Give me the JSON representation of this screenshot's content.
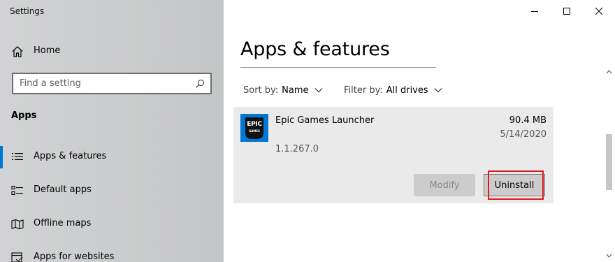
{
  "window": {
    "app_title": "Settings",
    "caption_buttons": [
      "minimize",
      "maximize",
      "close"
    ]
  },
  "sidebar": {
    "home_label": "Home",
    "search": {
      "placeholder": "Find a setting",
      "value": ""
    },
    "section_title": "Apps",
    "items": [
      {
        "label": "Apps & features",
        "icon": "list-icon",
        "selected": true
      },
      {
        "label": "Default apps",
        "icon": "default-apps-icon",
        "selected": false
      },
      {
        "label": "Offline maps",
        "icon": "map-icon",
        "selected": false
      },
      {
        "label": "Apps for websites",
        "icon": "apps-for-websites-icon",
        "selected": false
      }
    ]
  },
  "main": {
    "title": "Apps & features",
    "sort": {
      "label": "Sort by:",
      "value": "Name"
    },
    "filter": {
      "label": "Filter by:",
      "value": "All drives"
    },
    "app": {
      "name": "Epic Games Launcher",
      "size": "90.4 MB",
      "date": "5/14/2020",
      "version": "1.1.267.0",
      "logo_text": "EPIC",
      "logo_subtext": "GAMES",
      "modify_label": "Modify",
      "modify_enabled": false,
      "uninstall_label": "Uninstall"
    }
  },
  "colors": {
    "accent": "#0078d7",
    "highlight": "#e0191e"
  }
}
